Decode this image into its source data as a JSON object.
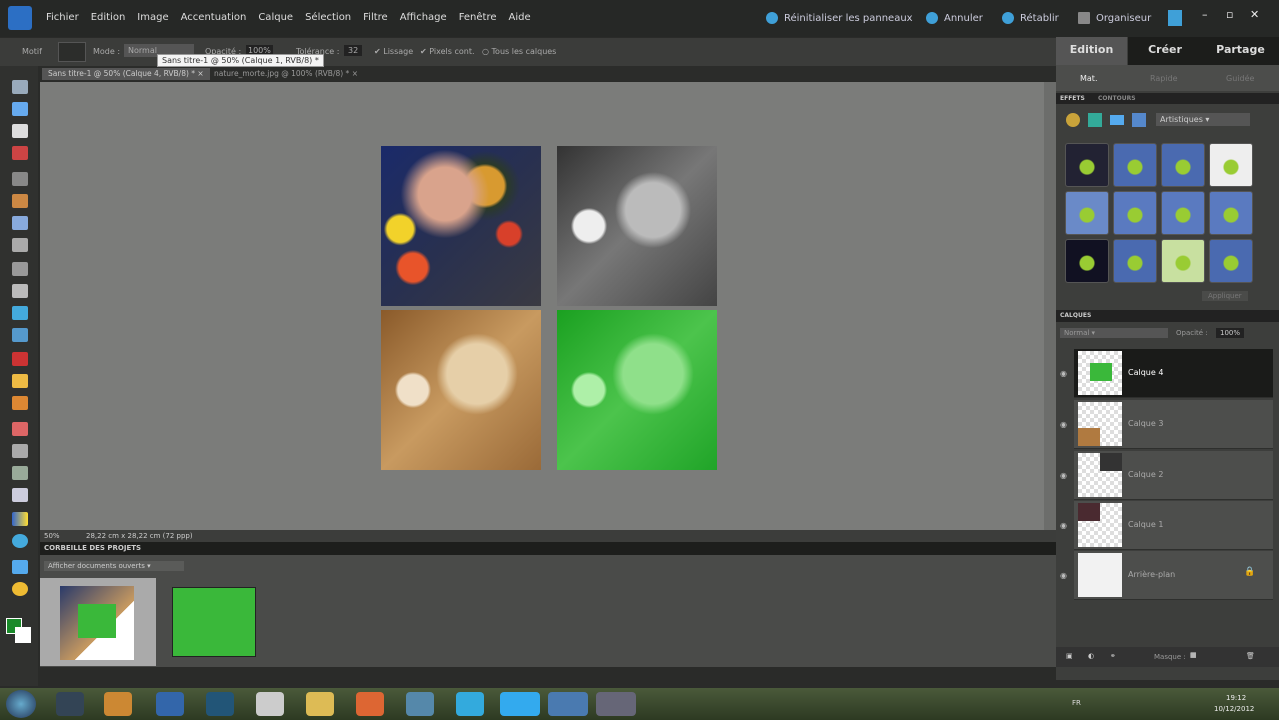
{
  "menubar": {
    "items": [
      "Fichier",
      "Edition",
      "Image",
      "Accentuation",
      "Calque",
      "Sélection",
      "Filtre",
      "Affichage",
      "Fenêtre",
      "Aide"
    ],
    "reset_panels": "Réinitialiser les panneaux",
    "undo": "Annuler",
    "redo": "Rétablir",
    "organizer": "Organiseur"
  },
  "options": {
    "motif": "Motif",
    "mode": "Mode :",
    "mode_value": "Normal",
    "opacity": "Opacité :",
    "opacity_value": "100%",
    "tolerance": "Tolérance :",
    "tolerance_value": "32",
    "lissage": "Lissage",
    "pixels_contigus": "Pixels cont.",
    "tous_calques": "Tous les calques"
  },
  "tooltip": "Sans titre-1 @ 50% (Calque 1, RVB/8) *",
  "tabs": [
    {
      "label": "Sans titre-1 @ 50% (Calque 4, RVB/8) *"
    },
    {
      "label": "nature_morte.jpg @ 100% (RVB/8) *"
    }
  ],
  "status": {
    "zoom": "50%",
    "size": "28,22 cm x 28,22 cm (72 ppp)"
  },
  "project_bin": {
    "title": "CORBEILLE DES PROJETS",
    "dropdown": "Afficher documents ouverts"
  },
  "panel": {
    "tabs": [
      "Edition",
      "Créer",
      "Partage"
    ],
    "subtabs": [
      "Mat.",
      "Rapide",
      "Guidée"
    ],
    "effects_tabs": [
      "EFFETS",
      "CONTOURS"
    ],
    "effects_dropdown": "Artistiques",
    "apply": "Appliquer",
    "layers_title": "CALQUES",
    "blend": "Normal",
    "opacity_label": "Opacité :",
    "opacity_value": "100%",
    "layers": [
      {
        "name": "Calque 4",
        "selected": true
      },
      {
        "name": "Calque 3"
      },
      {
        "name": "Calque 2"
      },
      {
        "name": "Calque 1"
      },
      {
        "name": "Arrière-plan",
        "locked": true
      }
    ],
    "mask_label": "Masque :"
  },
  "taskbar": {
    "lang": "FR",
    "time": "19:12",
    "date": "10/12/2012"
  }
}
